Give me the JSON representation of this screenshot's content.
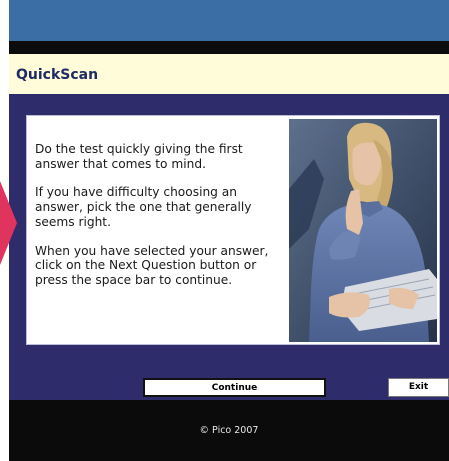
{
  "app": {
    "title": "QuickScan"
  },
  "instructions": {
    "paragraphs": [
      "Do the test quickly giving the first answer that comes to mind.",
      "If you have difficulty choosing an answer, pick the one that generally seems right.",
      "When you have selected your answer, click on the Next Question button or press the space bar to continue."
    ]
  },
  "buttons": {
    "continue_label": "Continue",
    "exit_label": "Exit"
  },
  "footer": {
    "copyright": "© Pico 2007"
  },
  "colors": {
    "window_blue": "#3a6ea5",
    "header_cream": "#fffcd9",
    "panel_navy": "#2e2c6a",
    "pointer_pink": "#e0335d"
  }
}
